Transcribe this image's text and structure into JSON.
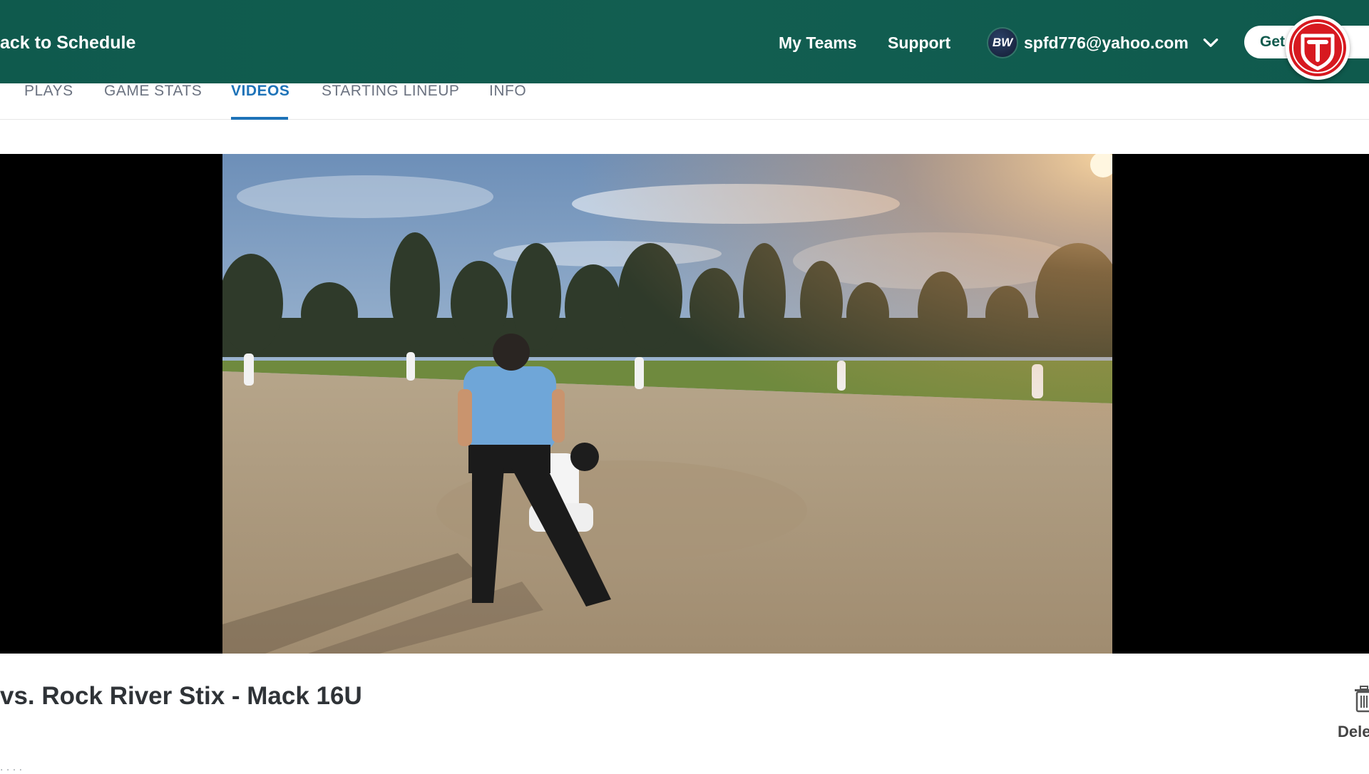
{
  "header": {
    "back_label": "ack to Schedule",
    "nav": {
      "my_teams": "My Teams",
      "support": "Support"
    },
    "user": {
      "initials": "BW",
      "email": "spfd776@yahoo.com"
    },
    "cta_label": "Get",
    "icons": {
      "chevron": "chevron-down-icon",
      "logo": "shield-logo-icon"
    }
  },
  "tabs": [
    {
      "label": "PLAYS",
      "active": false
    },
    {
      "label": "GAME STATS",
      "active": false
    },
    {
      "label": "VIDEOS",
      "active": true
    },
    {
      "label": "STARTING LINEUP",
      "active": false
    },
    {
      "label": "INFO",
      "active": false
    }
  ],
  "video": {
    "scene": "softball game: umpire and catcher behind home plate, fielders in position at sunset",
    "title": "vs. Rock River Stix - Mack 16U",
    "meta": ". . . ."
  },
  "actions": {
    "delete_label": "Dele",
    "delete_icon": "trash-icon"
  },
  "colors": {
    "header_bg": "#0f5a4d",
    "tab_active": "#1e73b8",
    "tab_inactive": "#6b7280",
    "logo_red": "#d71920"
  }
}
